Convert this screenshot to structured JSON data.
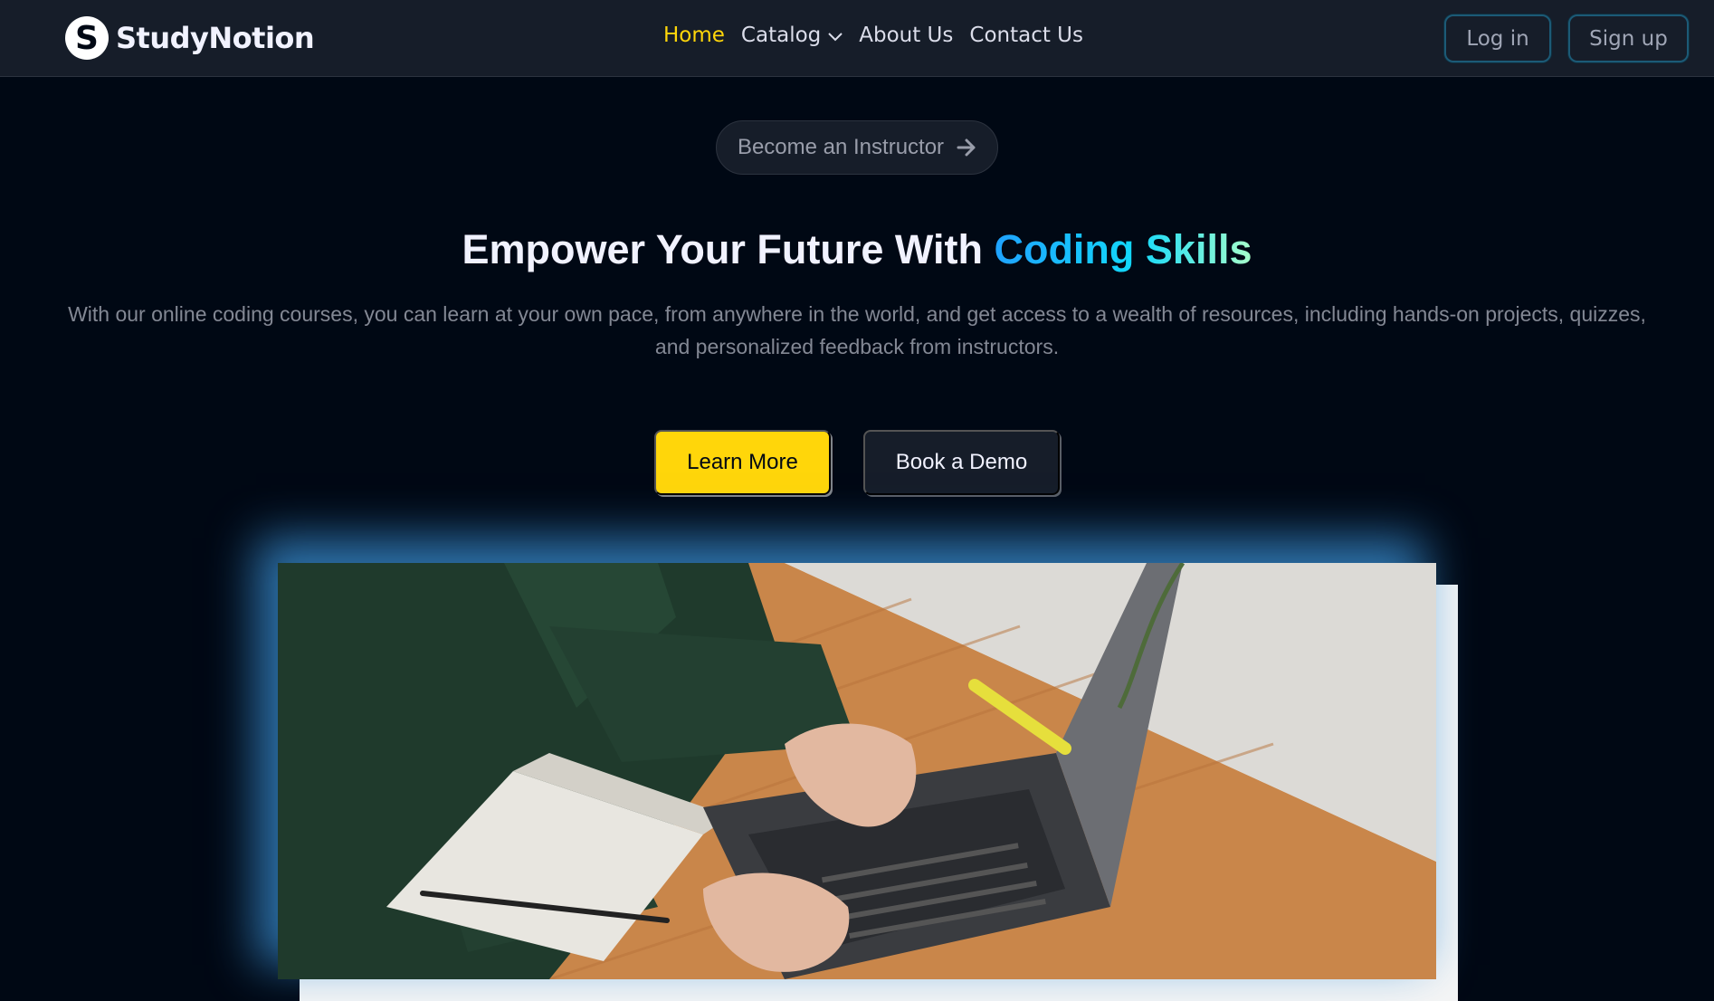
{
  "brand": {
    "name": "StudyNotion",
    "mark": "S"
  },
  "nav": {
    "items": [
      {
        "label": "Home",
        "active": true
      },
      {
        "label": "Catalog",
        "has_dropdown": true
      },
      {
        "label": "About Us"
      },
      {
        "label": "Contact Us"
      }
    ]
  },
  "auth": {
    "login_label": "Log in",
    "signup_label": "Sign up"
  },
  "hero": {
    "instructor_label": "Become an Instructor",
    "headline_prefix": "Empower Your Future With ",
    "headline_highlight": "Coding Skills",
    "subtext": "With our online coding courses, you can learn at your own pace, from anywhere in the world, and get access to a wealth of resources, including hands-on projects, quizzes, and personalized feedback from instructors.",
    "learn_more_label": "Learn More",
    "book_demo_label": "Book a Demo"
  },
  "colors": {
    "accent_yellow": "#ffd60a",
    "background": "#000814",
    "navbar": "#161d29",
    "gradient": [
      "#1fa2ff",
      "#12d8fa",
      "#a6ffcb"
    ]
  },
  "icons": {
    "catalog_dropdown": "chevron-down-icon",
    "instructor_arrow": "arrow-right-icon"
  }
}
